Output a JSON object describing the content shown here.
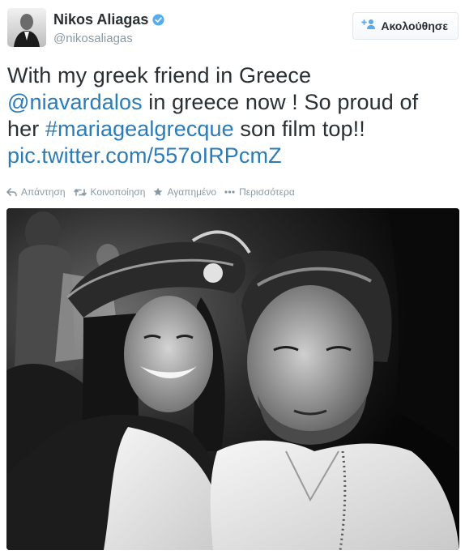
{
  "author": {
    "name": "Nikos Aliagas",
    "handle": "@nikosaliagas",
    "verified": true
  },
  "follow_button": {
    "label": "Ακολούθησε",
    "icon": "add-user-icon"
  },
  "tweet": {
    "line1": "With my greek friend in Greece",
    "mention": "@niavardalos",
    "line2_rest": " in greece now ! So proud of",
    "line3_prefix": "her ",
    "hashtag": "#mariagealgrecque",
    "line3_rest": " son film top!!",
    "link": "pic.twitter.com/557oIRPcmZ"
  },
  "actions": [
    {
      "label": "Απάντηση",
      "icon": "reply-icon"
    },
    {
      "label": "Κοινοποίηση",
      "icon": "retweet-icon"
    },
    {
      "label": "Αγαπημένο",
      "icon": "star-icon"
    },
    {
      "label": "Περισσότερα",
      "icon": "more-dots-icon"
    }
  ],
  "colors": {
    "link": "#2b7bb9",
    "text": "#292f33",
    "muted": "#8899a6",
    "verified": "#55acee"
  },
  "media": {
    "kind": "black-and-white selfie photo"
  }
}
